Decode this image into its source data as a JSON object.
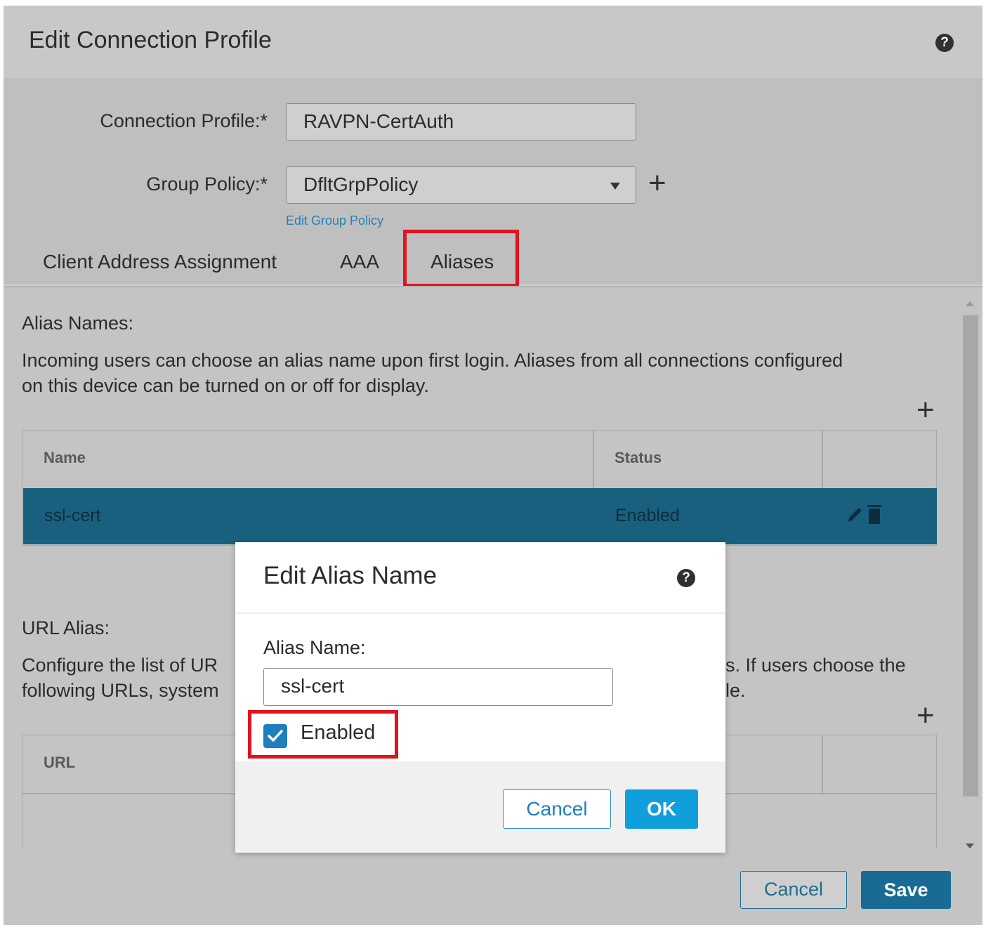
{
  "dialog": {
    "title": "Edit Connection Profile",
    "help_icon": "question-icon",
    "connection_profile_label": "Connection Profile:*",
    "connection_profile_value": "RAVPN-CertAuth",
    "group_policy_label": "Group Policy:*",
    "group_policy_value": "DfltGrpPolicy",
    "add_icon": "+",
    "edit_group_policy_link": "Edit Group Policy",
    "tabs": [
      {
        "label": "Client Address Assignment"
      },
      {
        "label": "AAA"
      },
      {
        "label": "Aliases",
        "active": true
      }
    ]
  },
  "aliases": {
    "section_title": "Alias Names:",
    "description_line1": "Incoming users can choose an alias name upon first login. Aliases from all connections configured",
    "description_line2": "on this device can be turned on or off for display.",
    "add_icon": "+",
    "table_headers": {
      "name": "Name",
      "status": "Status"
    },
    "rows": [
      {
        "name": "ssl-cert",
        "status": "Enabled",
        "actions": [
          "pencil-icon",
          "trash-icon"
        ]
      }
    ]
  },
  "url_alias": {
    "section_title": "URL Alias:",
    "desc_left_line1": "Configure the list of UR",
    "desc_left_line2": "following URLs, system",
    "desc_right_line1": "s. If users choose the",
    "desc_right_line2": "le.",
    "add_icon": "+",
    "table_headers": {
      "url": "URL"
    }
  },
  "footer": {
    "cancel_label": "Cancel",
    "save_label": "Save"
  },
  "modal": {
    "title": "Edit Alias Name",
    "help_icon": "question-icon",
    "alias_label": "Alias Name:",
    "alias_value": "ssl-cert",
    "enabled_label": "Enabled",
    "enabled_checked": true,
    "cancel_label": "Cancel",
    "ok_label": "OK"
  },
  "colors": {
    "selected_row": "#19607f",
    "highlight_red": "#e0141f",
    "primary_blue": "#0fa0db",
    "link_blue": "#2a7fb5"
  }
}
